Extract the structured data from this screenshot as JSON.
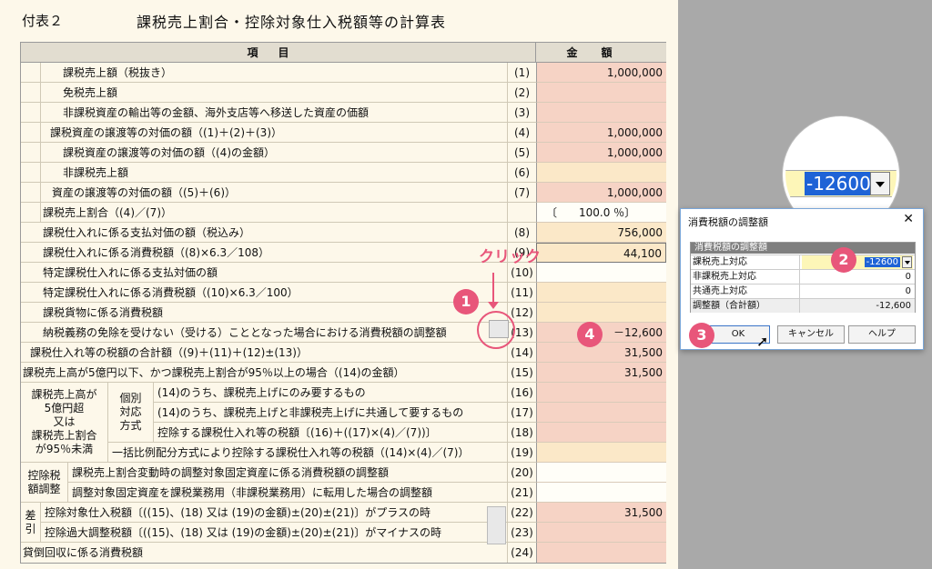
{
  "header": {
    "label": "付表２",
    "title": "課税売上割合・控除対象仕入税額等の計算表"
  },
  "columns": {
    "item": "項目",
    "amount": "金額"
  },
  "rows": [
    {
      "label": "課税売上額（税抜き）",
      "num": "(1)",
      "amount": "1,000,000"
    },
    {
      "label": "免税売上額",
      "num": "(2)",
      "amount": ""
    },
    {
      "label": "非課税資産の輸出等の金額、海外支店等へ移送した資産の価額",
      "num": "(3)",
      "amount": ""
    },
    {
      "label": "課税資産の譲渡等の対価の額（(1)＋(2)＋(3)）",
      "num": "(4)",
      "amount": "1,000,000"
    },
    {
      "label": "課税資産の譲渡等の対価の額（(4)の金額）",
      "num": "(5)",
      "amount": "1,000,000"
    },
    {
      "label": "非課税売上額",
      "num": "(6)",
      "amount": ""
    },
    {
      "label": "資産の譲渡等の対価の額（(5)＋(6)）",
      "num": "(7)",
      "amount": "1,000,000"
    },
    {
      "label": "課税売上割合（(4)／(7)）",
      "num": "",
      "amount": "〔　　100.0 ％〕"
    },
    {
      "label": "課税仕入れに係る支払対価の額（税込み）",
      "num": "(8)",
      "amount": "756,000"
    },
    {
      "label": "課税仕入れに係る消費税額（(8)×6.3／108）",
      "num": "(9)",
      "amount": "44,100"
    },
    {
      "label": "特定課税仕入れに係る支払対価の額",
      "num": "(10)",
      "amount": ""
    },
    {
      "label": "特定課税仕入れに係る消費税額（(10)×6.3／100）",
      "num": "(11)",
      "amount": ""
    },
    {
      "label": "課税貨物に係る消費税額",
      "num": "(12)",
      "amount": ""
    },
    {
      "label": "納税義務の免除を受けない（受ける）こととなった場合における消費税額の調整額",
      "num": "(13)",
      "amount": "－12,600"
    },
    {
      "label": "課税仕入れ等の税額の合計額（(9)＋(11)＋(12)±(13)）",
      "num": "(14)",
      "amount": "31,500"
    },
    {
      "label": "課税売上高が5億円以下、かつ課税売上割合が95％以上の場合（(14)の金額）",
      "num": "(15)",
      "amount": "31,500"
    },
    {
      "label": "(14)のうち、課税売上げにのみ要するもの",
      "num": "(16)",
      "amount": ""
    },
    {
      "label": "(14)のうち、課税売上げと非課税売上げに共通して要するもの",
      "num": "(17)",
      "amount": ""
    },
    {
      "label": "控除する課税仕入れ等の税額〔(16)＋((17)×(4)／(7))〕",
      "num": "(18)",
      "amount": ""
    },
    {
      "label": "一括比例配分方式により控除する課税仕入れ等の税額（(14)×(4)／(7)）",
      "num": "(19)",
      "amount": ""
    },
    {
      "label": "課税売上割合変動時の調整対象固定資産に係る消費税額の調整額",
      "num": "(20)",
      "amount": ""
    },
    {
      "label": "調整対象固定資産を課税業務用（非課税業務用）に転用した場合の調整額",
      "num": "(21)",
      "amount": ""
    },
    {
      "label": "控除対象仕入税額〔((15)、(18) 又は (19)の金額)±(20)±(21)〕がプラスの時",
      "num": "(22)",
      "amount": "31,500"
    },
    {
      "label": "控除過大調整税額〔((15)、(18) 又は (19)の金額)±(20)±(21)〕がマイナスの時",
      "num": "(23)",
      "amount": ""
    },
    {
      "label": "貸倒回収に係る消費税額",
      "num": "(24)",
      "amount": ""
    }
  ],
  "blocks": {
    "over500m": "課税売上高が\n5億円超\n又は\n課税売上割合\nが95％未満",
    "individual": "個別\n対応\n方式",
    "deduction_adjust": "控除税\n額調整",
    "difference": "差\n引"
  },
  "annotations": {
    "click_text": "クリック",
    "badge1": "1",
    "badge2": "2",
    "badge3": "3",
    "badge4": "4",
    "magnified_value": "-12600"
  },
  "dialog": {
    "title": "消費税額の調整額",
    "group_title": "消費税額の調整額",
    "rows": [
      {
        "label": "課税売上対応",
        "value": "-12600"
      },
      {
        "label": "非課税売上対応",
        "value": "0"
      },
      {
        "label": "共通売上対応",
        "value": "0"
      },
      {
        "label": "調整額（合計額）",
        "value": "-12,600"
      }
    ],
    "ok": "OK",
    "cancel": "キャンセル",
    "help": "ヘルプ"
  }
}
